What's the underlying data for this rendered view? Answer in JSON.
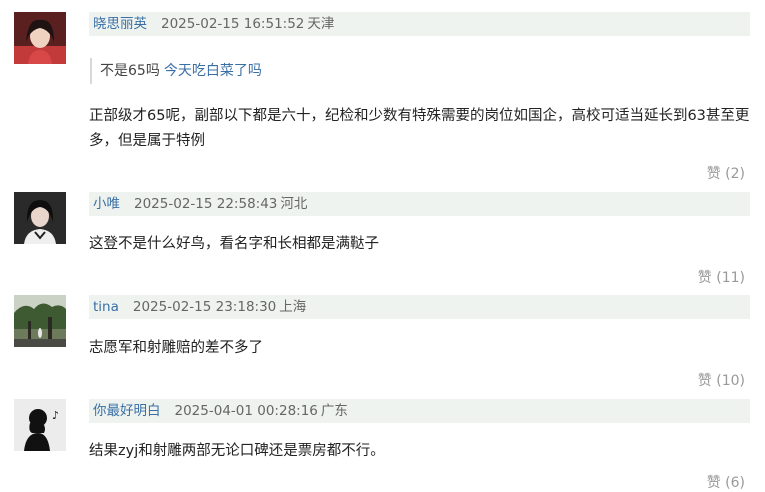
{
  "comments": [
    {
      "username": "晓思丽英",
      "timestamp": "2025-02-15 16:51:52",
      "location": "天津",
      "quote": {
        "text": "不是65吗",
        "link": "今天吃白菜了吗"
      },
      "text": "正部级才65呢，副部以下都是六十，纪检和少数有特殊需要的岗位如国企，高校可适当延长到63甚至更多，但是属于特例",
      "like_label": "赞",
      "likes": "(2)"
    },
    {
      "username": "小唯",
      "timestamp": "2025-02-15 22:58:43",
      "location": "河北",
      "text": "这登不是什么好鸟，看名字和长相都是满鞑子",
      "like_label": "赞",
      "likes": "(11)"
    },
    {
      "username": "tina",
      "timestamp": "2025-02-15 23:18:30",
      "location": "上海",
      "text": "志愿军和射雕赔的差不多了",
      "like_label": "赞",
      "likes": "(10)"
    },
    {
      "username": "你最好明白",
      "timestamp": "2025-04-01 00:28:16",
      "location": "广东",
      "text": "结果zyj和射雕两部无论口碑还是票房都不行。",
      "like_label": "赞",
      "likes": "(6)"
    }
  ]
}
